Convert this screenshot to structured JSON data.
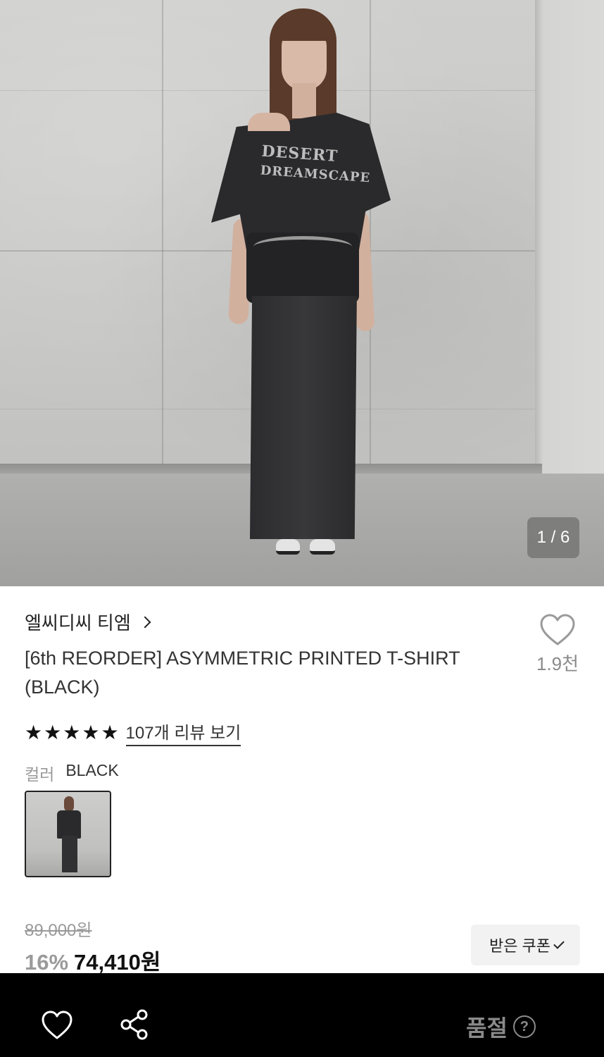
{
  "gallery": {
    "counter": "1 / 6",
    "tee_print_line1": "DESERT",
    "tee_print_line2": "DREAMSCAPE"
  },
  "product": {
    "brand": "엘씨디씨 티엠",
    "title": "[6th REORDER] ASYMMETRIC PRINTED T-SHIRT (BLACK)",
    "like_count": "1.9천",
    "rating_stars": 5,
    "review_link": "107개 리뷰 보기",
    "color_label": "컬러",
    "color_value": "BLACK",
    "original_price": "89,000원",
    "discount": "16%",
    "price": "74,410원",
    "coupon_button": "받은 쿠폰"
  },
  "bottom_bar": {
    "status": "품절",
    "help_icon": "?"
  },
  "colors": {
    "bottom_bar_bg": "#000000",
    "muted_text": "#9a9a9a",
    "accent_text": "#111111"
  },
  "icons": {
    "brand_arrow": "chevron-right-icon",
    "like": "heart-outline-icon",
    "star": "star-filled-icon",
    "coupon_check": "check-icon",
    "share": "share-icon",
    "help": "question-circle-icon"
  }
}
